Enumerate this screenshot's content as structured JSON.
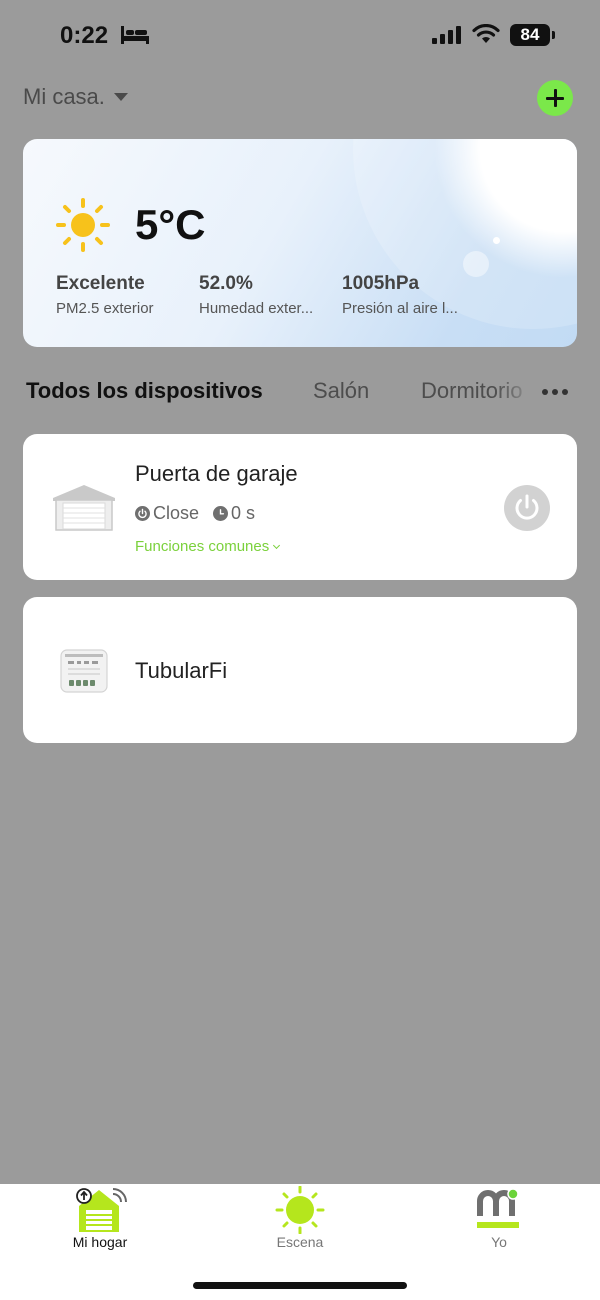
{
  "status_bar": {
    "time": "0:22",
    "battery": "84",
    "icons": [
      "bed-icon",
      "signal-icon",
      "wifi-icon",
      "battery-icon"
    ]
  },
  "header": {
    "home_name": "Mi casa.",
    "icons": [
      "chevron-down-icon",
      "add-icon"
    ],
    "add_color": "#7be84a"
  },
  "weather": {
    "icon": "sun-icon",
    "temperature": "5°C",
    "metrics": [
      {
        "value": "Excelente",
        "label": "PM2.5 exterior"
      },
      {
        "value": "52.0%",
        "label": "Humedad exter..."
      },
      {
        "value": "1005hPa",
        "label": "Presión al aire l..."
      }
    ]
  },
  "rooms": {
    "tabs": [
      "Todos los dispositivos",
      "Salón",
      "Dormitorio"
    ],
    "active_index": 0,
    "more_icon": "more-icon"
  },
  "devices": [
    {
      "name": "Puerta de garaje",
      "icon": "garage-door-icon",
      "status": "Close",
      "status_icon": "power-icon",
      "timer": "0 s",
      "timer_icon": "clock-icon",
      "functions_label": "Funciones comunes",
      "power_button_icon": "power-icon"
    },
    {
      "name": "TubularFi",
      "icon": "curtain-module-icon"
    }
  ],
  "bottom_nav": [
    {
      "label": "Mi hogar",
      "icon": "home-garage-icon",
      "active": true
    },
    {
      "label": "Escena",
      "icon": "sun-icon",
      "active": false
    },
    {
      "label": "Yo",
      "icon": "profile-logo-icon",
      "active": false
    }
  ],
  "colors": {
    "background": "#9b9b9b",
    "accent_green": "#7bd13c",
    "scene_yellow_green": "#b5e61d"
  }
}
